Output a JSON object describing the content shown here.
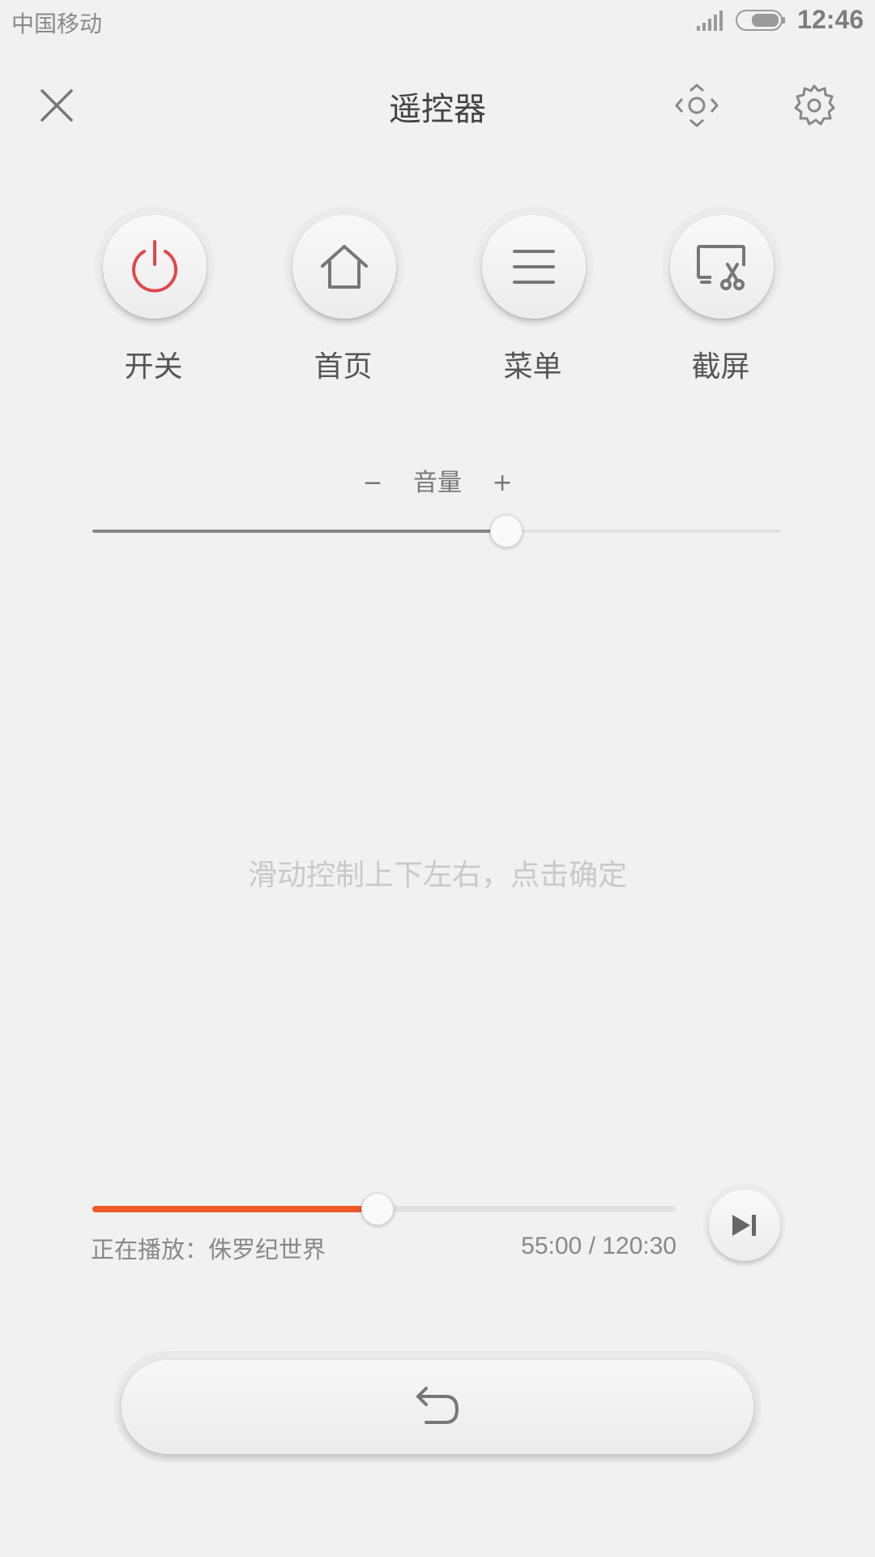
{
  "status_bar": {
    "carrier": "中国移动",
    "time": "12:46",
    "icons": [
      "signal-icon",
      "battery-icon"
    ]
  },
  "header": {
    "title": "遥控器",
    "icons": [
      "close-icon",
      "dpad-icon",
      "gear-icon"
    ]
  },
  "quick_buttons": [
    {
      "label": "开关",
      "icon": "power-icon",
      "color": "#e0474a"
    },
    {
      "label": "首页",
      "icon": "home-icon"
    },
    {
      "label": "菜单",
      "icon": "menu-icon"
    },
    {
      "label": "截屏",
      "icon": "screenshot-icon"
    }
  ],
  "volume": {
    "label": "音量",
    "minus": "−",
    "plus": "+",
    "level_fraction": 0.6
  },
  "touchpad": {
    "hint": "滑动控制上下左右，点击确定"
  },
  "playback": {
    "progress_fraction": 0.4875,
    "accent_color": "#f0582a",
    "now_playing": "正在播放：侏罗纪世界",
    "time": "55:00 / 120:30",
    "next_icon": "skip-next-icon"
  },
  "back": {
    "icon": "back-arrow-icon"
  }
}
